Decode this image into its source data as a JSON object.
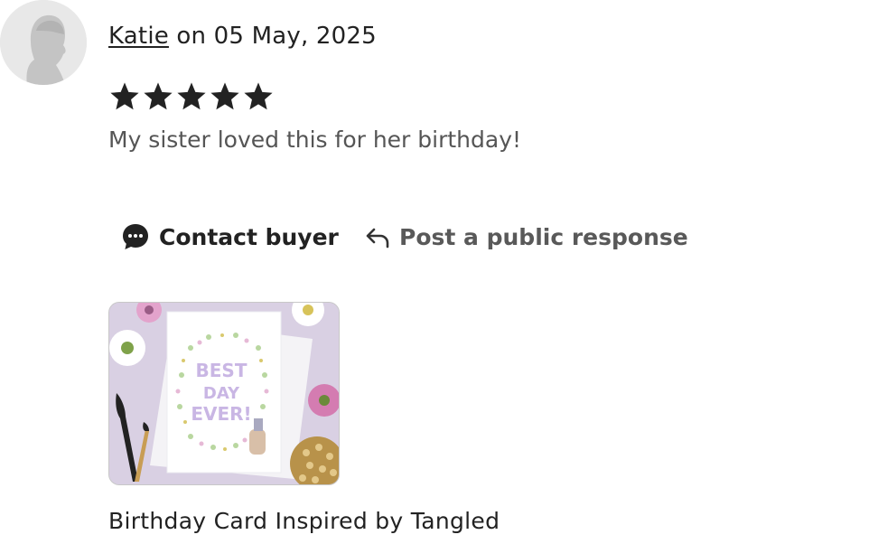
{
  "review": {
    "reviewer_name": "Katie",
    "date_text": " on 05 May, 2025",
    "rating": 5,
    "rating_max": 5,
    "text": "My sister loved this for her birthday!"
  },
  "actions": {
    "contact_label": "Contact buyer",
    "respond_label": "Post a public response"
  },
  "listing": {
    "title": "Birthday Card Inspired by Tangled",
    "card_lines": [
      "BEST",
      "DAY",
      "EVER!"
    ]
  },
  "icons": {
    "avatar": "default-user-avatar-icon",
    "star": "star-filled-icon",
    "contact": "chat-bubble-icon",
    "respond": "reply-arrow-icon"
  },
  "colors": {
    "star": "#222222",
    "text_primary": "#222222",
    "text_secondary": "#555555",
    "card_lettering": "#c9b6e4",
    "thumb_background": "#d9d0e3"
  }
}
